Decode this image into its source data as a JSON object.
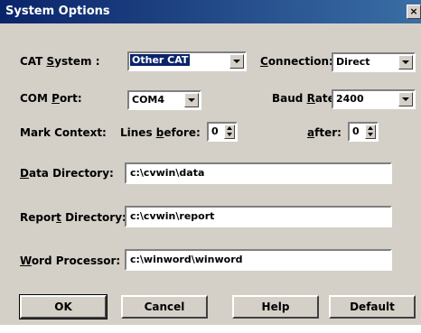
{
  "window": {
    "title": "System Options",
    "close": "×"
  },
  "form": {
    "cat_system": {
      "label_pre": "CAT ",
      "label_key": "S",
      "label_post": "ystem :",
      "value": "Other CAT"
    },
    "connection": {
      "label_key": "C",
      "label_post": "onnection:",
      "value": "Direct"
    },
    "com_port": {
      "label_pre": "COM ",
      "label_key": "P",
      "label_post": "ort:",
      "value": "COM4"
    },
    "baud_rate": {
      "label_pre": "Baud ",
      "label_key": "R",
      "label_post": "ate:",
      "value": "2400"
    },
    "mark_context": {
      "label": "Mark Context:",
      "before_label_pre": "Lines ",
      "before_label_key": "b",
      "before_label_post": "efore:",
      "before_value": "0",
      "after_label_key": "a",
      "after_label_post": "fter:",
      "after_value": "0"
    },
    "data_directory": {
      "label_key": "D",
      "label_post": "ata Directory:",
      "value": "c:\\cvwin\\data"
    },
    "report_directory": {
      "label_pre": "Repor",
      "label_key": "t",
      "label_post": " Directory:",
      "value": "c:\\cvwin\\report"
    },
    "word_processor": {
      "label_key": "W",
      "label_post": "ord Processor:",
      "value": "c:\\winword\\winword"
    }
  },
  "buttons": {
    "ok": "OK",
    "cancel": "Cancel",
    "help": "Help",
    "default": "Default"
  }
}
